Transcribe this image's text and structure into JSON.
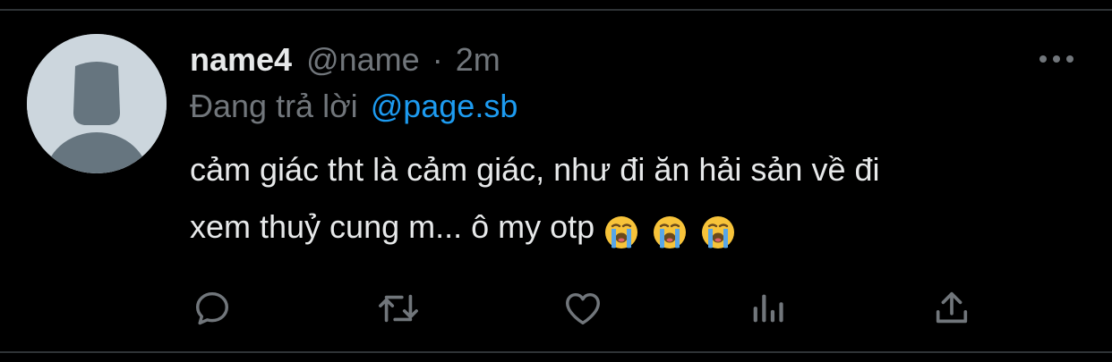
{
  "tweet": {
    "display_name": "name4",
    "handle": "@name",
    "separator": "·",
    "time": "2m",
    "reply_prefix": "Đang trả lời",
    "reply_to": "@page.sb",
    "text_line_1": "cảm giác tht là cảm giác, như đi ăn hải sản về đi",
    "text_line_2": "xem thuỷ cung m... ô my otp",
    "emojis": [
      "loudly-crying-face",
      "loudly-crying-face",
      "loudly-crying-face"
    ]
  },
  "actions": [
    "reply-icon",
    "retweet-icon",
    "like-icon",
    "analytics-icon",
    "share-icon"
  ],
  "colors": {
    "background": "#000000",
    "text": "#e7e9ea",
    "secondary": "#71767b",
    "accent": "#1d9bf0",
    "avatar_bg": "#ccd6dd",
    "avatar_figure": "#66757f"
  }
}
